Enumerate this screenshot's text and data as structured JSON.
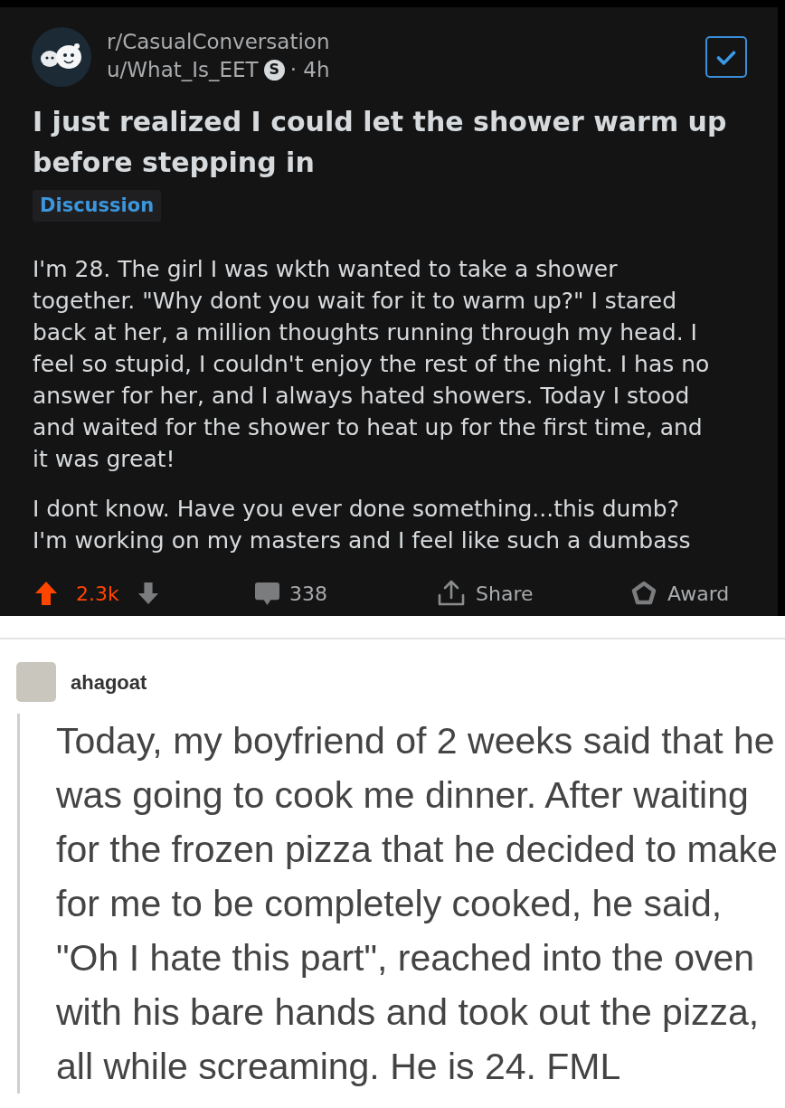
{
  "reddit_post": {
    "subreddit": "r/CasualConversation",
    "author": "u/What_Is_EET",
    "author_badge": "S",
    "time": "· 4h",
    "checkbox": {
      "checked": true
    },
    "title": "I just realized I could let the shower warm up before stepping in",
    "flair": "Discussion",
    "body": [
      "I'm 28. The girl I was wkth wanted to take a shower together. \"Why dont you wait for it to warm up?\" I stared back at her, a million thoughts running through my head. I feel so stupid, I couldn't enjoy the rest of the night. I has no answer for her, and I always hated showers. Today I stood and waited for the shower to heat up for the first time, and it was great!",
      "I dont know. Have you ever done something...this dumb? I'm working on my masters and I feel like such a dumbass"
    ],
    "actions": {
      "upvoted": true,
      "score": "2.3k",
      "comments": "338",
      "share": "Share",
      "award": "Award"
    }
  },
  "tumblr_post": {
    "username": "ahagoat",
    "text": "Today, my boyfriend of 2 weeks said that he was going to cook me dinner. After waiting for the frozen pizza that he decided to make for me to be completely cooked, he said, \"Oh I hate this part\", reached into the oven with his bare hands and took out the pizza, all while screaming. He is 24. FML"
  }
}
